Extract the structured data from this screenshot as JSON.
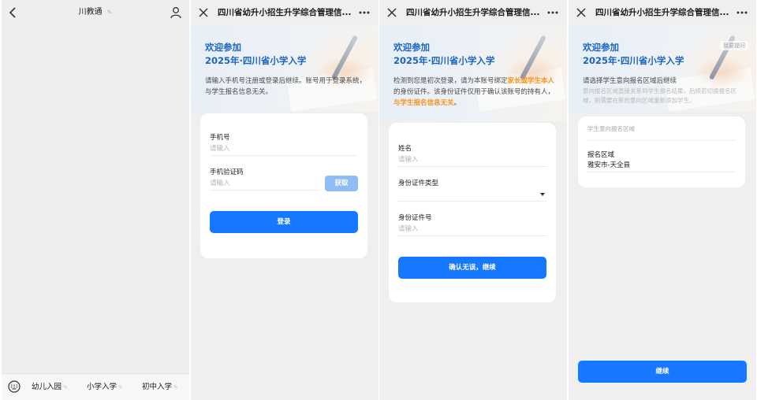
{
  "screen1": {
    "title": "川教通",
    "bottom_tabs": [
      {
        "label": "幼儿入园"
      },
      {
        "label": "小学入学"
      },
      {
        "label": "初中入学"
      }
    ]
  },
  "screen2": {
    "title": "四川省幼升小招生升学综合管理信...",
    "hero_title_line1": "欢迎参加",
    "hero_title_line2": "2025年·四川省小学入学",
    "hero_desc": "请输入手机号注册或登录后继续。账号用于登录系统，与学生报名信息无关。",
    "phone_label": "手机号",
    "phone_placeholder": "请输入",
    "code_label": "手机验证码",
    "code_placeholder": "请输入",
    "get_code_button": "获取",
    "login_button": "登录"
  },
  "screen3": {
    "title": "四川省幼升小招生升学综合管理信...",
    "hero_title_line1": "欢迎参加",
    "hero_title_line2": "2025年·四川省小学入学",
    "hero_desc_a": "检测到您是初次登录，请为本账号绑定",
    "hero_desc_hl1": "家长或学生本人",
    "hero_desc_b": "的身份证件。该身份证件仅用于确认该账号的持有人，",
    "hero_desc_hl2": "与学生报名信息无关",
    "hero_desc_c": "。",
    "name_label": "姓名",
    "name_placeholder": "请输入",
    "id_type_label": "身份证件类型",
    "id_type_value": "",
    "id_number_label": "身份证件号",
    "id_number_placeholder": "请输入",
    "confirm_button": "确认无误，继续"
  },
  "screen4": {
    "title": "四川省幼升小招生升学综合管理信...",
    "tag": "我要提问",
    "hero_title_line1": "欢迎参加",
    "hero_title_line2": "2025年·四川省小学入学",
    "hero_desc": "请选择学生意向报名区域后继续",
    "hero_desc_faded": "意向报名区域直接关系到学生报名结果，后续若切换报名区域，则需要在新的意向区域重新添加学生。",
    "section_label": "学生意向报名区域",
    "region_label": "报名区域",
    "region_value": "雅安市-天全县",
    "continue_button": "继续"
  }
}
